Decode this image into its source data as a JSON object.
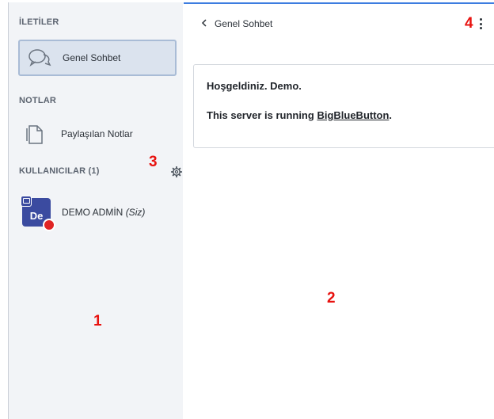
{
  "sidebar": {
    "messages_title": "İLETİLER",
    "public_chat_label": "Genel Sohbet",
    "notes_title": "NOTLAR",
    "shared_notes_label": "Paylaşılan Notlar",
    "users_title": "KULLANICILAR (1)",
    "user": {
      "initials": "De",
      "name": "DEMO ADMİN",
      "you_tag": "(Siz)"
    }
  },
  "chat": {
    "header_title": "Genel Sohbet",
    "welcome": "Hoşgeldiniz. Demo.",
    "server_prefix": "This server is running ",
    "server_link": "BigBlueButton",
    "server_suffix": "."
  },
  "annotations": {
    "one": "1",
    "two": "2",
    "three": "3",
    "four": "4"
  },
  "colors": {
    "accent": "#3d7de0",
    "avatar": "#3b4ba0",
    "moderator_badge": "#e02424",
    "annotation": "#e8120f"
  },
  "icons": {
    "public_chat": "chat-bubbles-icon",
    "shared_notes": "documents-icon",
    "user_settings": "gear-icon",
    "back": "chevron-left-icon",
    "options": "kebab-menu-icon"
  }
}
